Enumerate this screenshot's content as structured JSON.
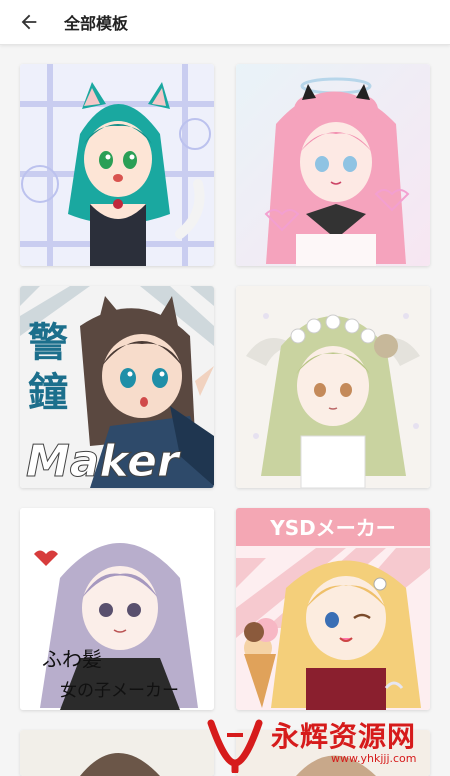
{
  "header": {
    "back_icon": "arrow-left-icon",
    "title": "全部模板"
  },
  "templates": [
    {
      "name": "catgirl-teal",
      "overlay_text": ""
    },
    {
      "name": "pink-angel",
      "overlay_text": ""
    },
    {
      "name": "keisho-maker",
      "overlay_text_1": "警",
      "overlay_text_2": "鐘",
      "overlay_text_3": "Maker"
    },
    {
      "name": "flower-crown",
      "overlay_text": ""
    },
    {
      "name": "fuwa-hair-girl",
      "overlay_text_1": "ふわ髪",
      "overlay_text_2": "女の子メーカー"
    },
    {
      "name": "ysd-maker",
      "overlay_text": "YSDメーカー"
    }
  ],
  "watermark": {
    "text": "永辉资源网",
    "url": "www.yhkjjj.com"
  },
  "colors": {
    "accent_red": "#d61b1b",
    "appbar_bg": "#ffffff",
    "page_bg": "#f5f5f5"
  }
}
